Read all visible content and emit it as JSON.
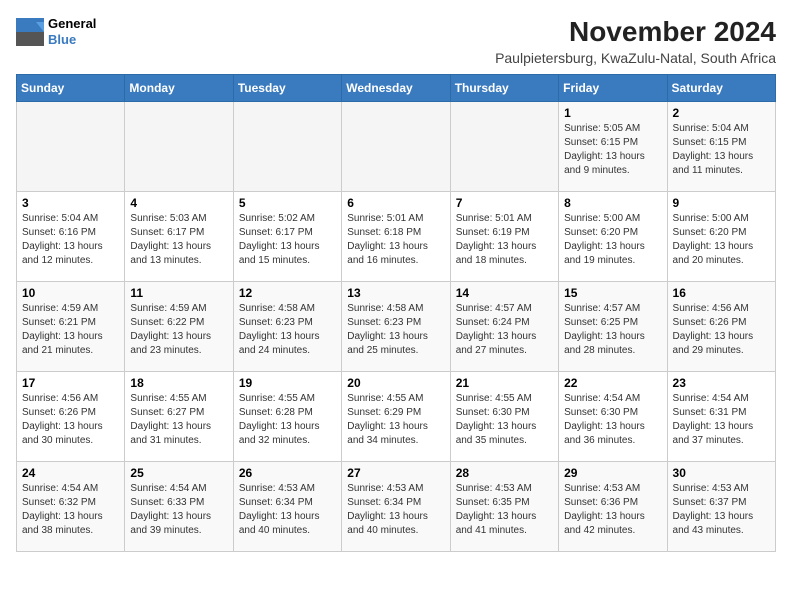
{
  "logo": {
    "line1": "General",
    "line2": "Blue"
  },
  "title": "November 2024",
  "subtitle": "Paulpietersburg, KwaZulu-Natal, South Africa",
  "days_of_week": [
    "Sunday",
    "Monday",
    "Tuesday",
    "Wednesday",
    "Thursday",
    "Friday",
    "Saturday"
  ],
  "weeks": [
    [
      {
        "day": "",
        "detail": ""
      },
      {
        "day": "",
        "detail": ""
      },
      {
        "day": "",
        "detail": ""
      },
      {
        "day": "",
        "detail": ""
      },
      {
        "day": "",
        "detail": ""
      },
      {
        "day": "1",
        "detail": "Sunrise: 5:05 AM\nSunset: 6:15 PM\nDaylight: 13 hours\nand 9 minutes."
      },
      {
        "day": "2",
        "detail": "Sunrise: 5:04 AM\nSunset: 6:15 PM\nDaylight: 13 hours\nand 11 minutes."
      }
    ],
    [
      {
        "day": "3",
        "detail": "Sunrise: 5:04 AM\nSunset: 6:16 PM\nDaylight: 13 hours\nand 12 minutes."
      },
      {
        "day": "4",
        "detail": "Sunrise: 5:03 AM\nSunset: 6:17 PM\nDaylight: 13 hours\nand 13 minutes."
      },
      {
        "day": "5",
        "detail": "Sunrise: 5:02 AM\nSunset: 6:17 PM\nDaylight: 13 hours\nand 15 minutes."
      },
      {
        "day": "6",
        "detail": "Sunrise: 5:01 AM\nSunset: 6:18 PM\nDaylight: 13 hours\nand 16 minutes."
      },
      {
        "day": "7",
        "detail": "Sunrise: 5:01 AM\nSunset: 6:19 PM\nDaylight: 13 hours\nand 18 minutes."
      },
      {
        "day": "8",
        "detail": "Sunrise: 5:00 AM\nSunset: 6:20 PM\nDaylight: 13 hours\nand 19 minutes."
      },
      {
        "day": "9",
        "detail": "Sunrise: 5:00 AM\nSunset: 6:20 PM\nDaylight: 13 hours\nand 20 minutes."
      }
    ],
    [
      {
        "day": "10",
        "detail": "Sunrise: 4:59 AM\nSunset: 6:21 PM\nDaylight: 13 hours\nand 21 minutes."
      },
      {
        "day": "11",
        "detail": "Sunrise: 4:59 AM\nSunset: 6:22 PM\nDaylight: 13 hours\nand 23 minutes."
      },
      {
        "day": "12",
        "detail": "Sunrise: 4:58 AM\nSunset: 6:23 PM\nDaylight: 13 hours\nand 24 minutes."
      },
      {
        "day": "13",
        "detail": "Sunrise: 4:58 AM\nSunset: 6:23 PM\nDaylight: 13 hours\nand 25 minutes."
      },
      {
        "day": "14",
        "detail": "Sunrise: 4:57 AM\nSunset: 6:24 PM\nDaylight: 13 hours\nand 27 minutes."
      },
      {
        "day": "15",
        "detail": "Sunrise: 4:57 AM\nSunset: 6:25 PM\nDaylight: 13 hours\nand 28 minutes."
      },
      {
        "day": "16",
        "detail": "Sunrise: 4:56 AM\nSunset: 6:26 PM\nDaylight: 13 hours\nand 29 minutes."
      }
    ],
    [
      {
        "day": "17",
        "detail": "Sunrise: 4:56 AM\nSunset: 6:26 PM\nDaylight: 13 hours\nand 30 minutes."
      },
      {
        "day": "18",
        "detail": "Sunrise: 4:55 AM\nSunset: 6:27 PM\nDaylight: 13 hours\nand 31 minutes."
      },
      {
        "day": "19",
        "detail": "Sunrise: 4:55 AM\nSunset: 6:28 PM\nDaylight: 13 hours\nand 32 minutes."
      },
      {
        "day": "20",
        "detail": "Sunrise: 4:55 AM\nSunset: 6:29 PM\nDaylight: 13 hours\nand 34 minutes."
      },
      {
        "day": "21",
        "detail": "Sunrise: 4:55 AM\nSunset: 6:30 PM\nDaylight: 13 hours\nand 35 minutes."
      },
      {
        "day": "22",
        "detail": "Sunrise: 4:54 AM\nSunset: 6:30 PM\nDaylight: 13 hours\nand 36 minutes."
      },
      {
        "day": "23",
        "detail": "Sunrise: 4:54 AM\nSunset: 6:31 PM\nDaylight: 13 hours\nand 37 minutes."
      }
    ],
    [
      {
        "day": "24",
        "detail": "Sunrise: 4:54 AM\nSunset: 6:32 PM\nDaylight: 13 hours\nand 38 minutes."
      },
      {
        "day": "25",
        "detail": "Sunrise: 4:54 AM\nSunset: 6:33 PM\nDaylight: 13 hours\nand 39 minutes."
      },
      {
        "day": "26",
        "detail": "Sunrise: 4:53 AM\nSunset: 6:34 PM\nDaylight: 13 hours\nand 40 minutes."
      },
      {
        "day": "27",
        "detail": "Sunrise: 4:53 AM\nSunset: 6:34 PM\nDaylight: 13 hours\nand 40 minutes."
      },
      {
        "day": "28",
        "detail": "Sunrise: 4:53 AM\nSunset: 6:35 PM\nDaylight: 13 hours\nand 41 minutes."
      },
      {
        "day": "29",
        "detail": "Sunrise: 4:53 AM\nSunset: 6:36 PM\nDaylight: 13 hours\nand 42 minutes."
      },
      {
        "day": "30",
        "detail": "Sunrise: 4:53 AM\nSunset: 6:37 PM\nDaylight: 13 hours\nand 43 minutes."
      }
    ]
  ]
}
